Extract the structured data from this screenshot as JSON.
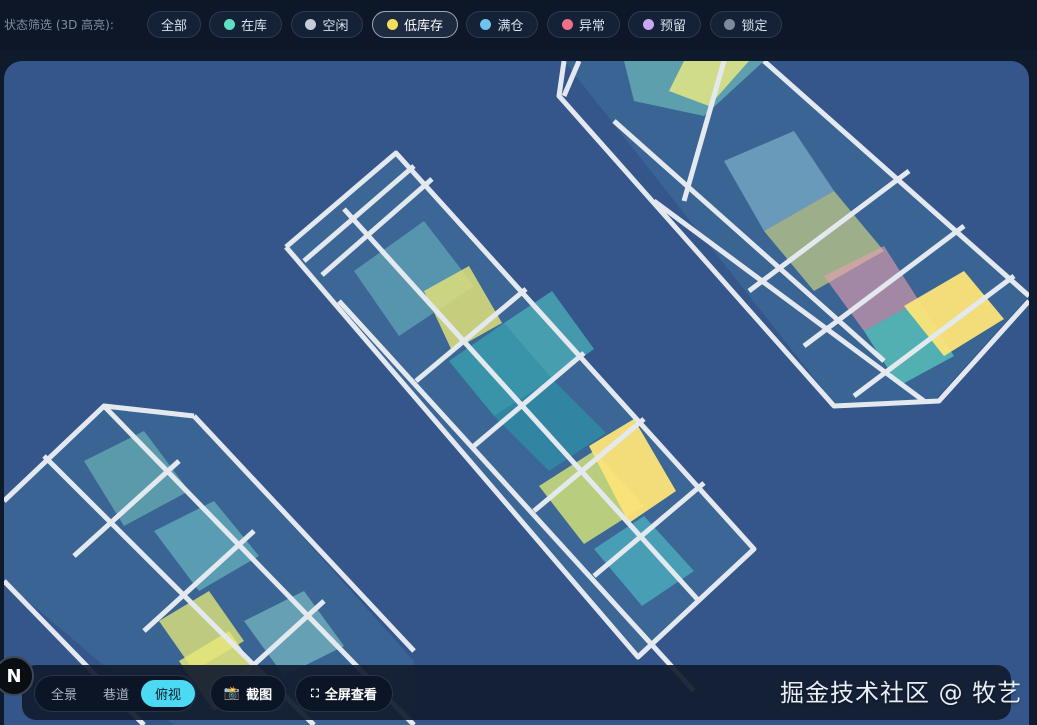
{
  "filter": {
    "label": "状态筛选 (3D 高亮):",
    "chips": [
      {
        "label": "全部",
        "color": null,
        "active": false
      },
      {
        "label": "在库",
        "color": "#5de0c5",
        "active": false
      },
      {
        "label": "空闲",
        "color": "#c4ccd6",
        "active": false
      },
      {
        "label": "低库存",
        "color": "#f7dd5f",
        "active": true
      },
      {
        "label": "满仓",
        "color": "#6fc4ef",
        "active": false
      },
      {
        "label": "异常",
        "color": "#ee6f86",
        "active": false
      },
      {
        "label": "预留",
        "color": "#c9a6f2",
        "active": false
      },
      {
        "label": "锁定",
        "color": "#7d8a9b",
        "active": false
      }
    ]
  },
  "scene": {
    "background": "#34568a",
    "rack_frame_color": "#e4e9f0",
    "bin_colors": {
      "in_stock": "#5de0c5",
      "low_stock": "#f7dd5f",
      "full": "#6fc4ef",
      "abnormal": "#ee6f86"
    }
  },
  "controls": {
    "views": [
      "全景",
      "巷道",
      "俯视"
    ],
    "active_view": "俯视",
    "screenshot_label": "截图",
    "fullscreen_label": "全屏查看"
  },
  "watermark": "掘金技术社区 @ 牧艺",
  "badge": "N"
}
